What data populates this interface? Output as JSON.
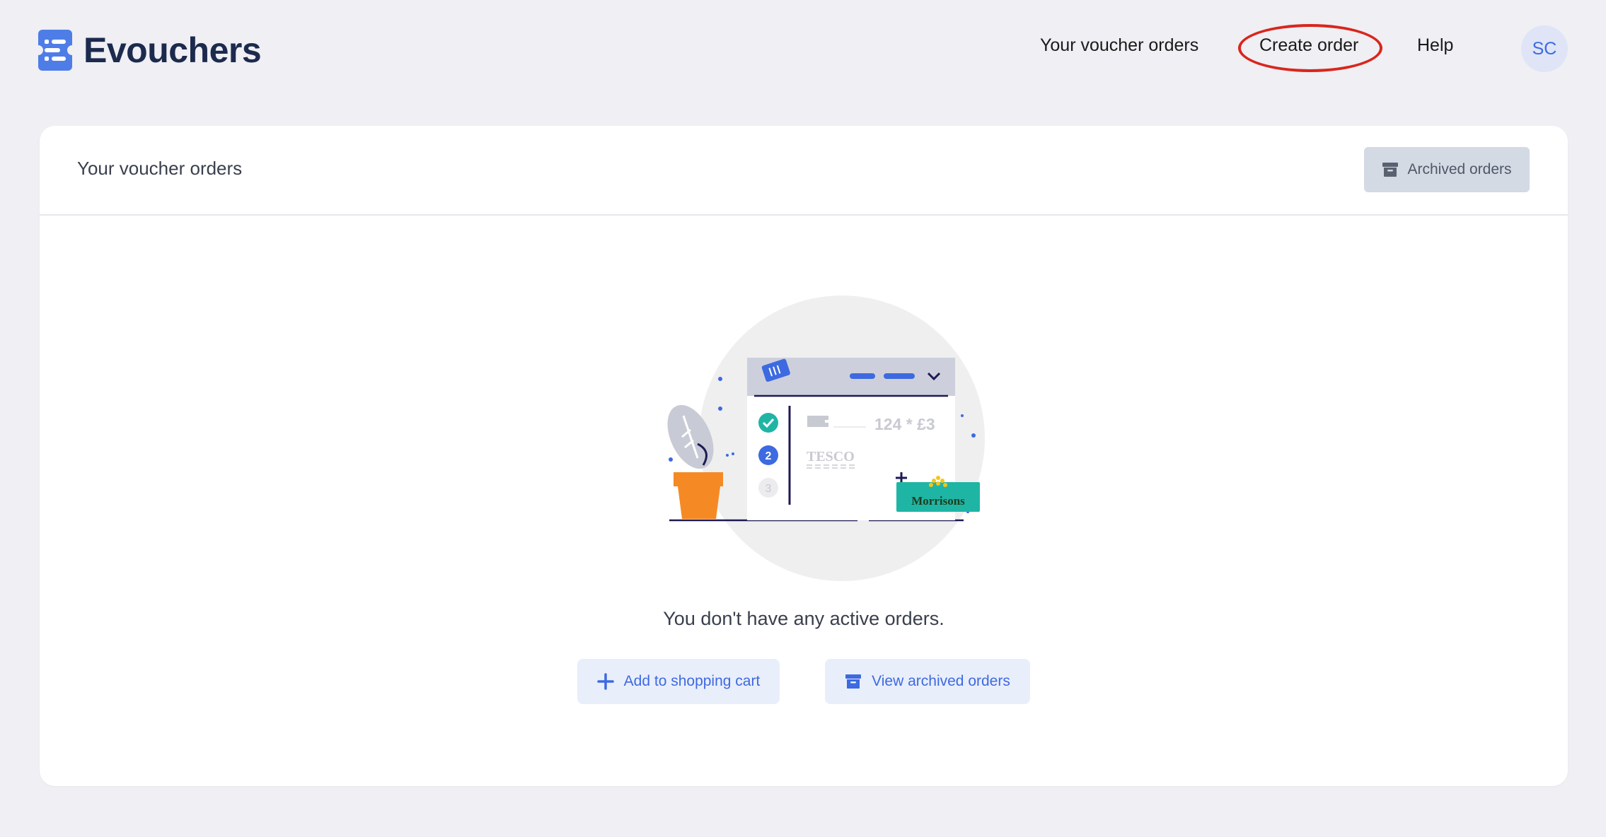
{
  "brand": {
    "name": "Evouchers"
  },
  "nav": {
    "orders": "Your voucher orders",
    "create": "Create order",
    "help": "Help",
    "avatar_initials": "SC"
  },
  "card": {
    "title": "Your voucher orders",
    "archived_button": "Archived orders"
  },
  "illustration": {
    "order_line": "124 * £3",
    "step_2": "2",
    "step_3": "3",
    "brand_tesco": "TESCO",
    "brand_morrisons": "Morrisons"
  },
  "empty_state": {
    "message": "You don't have any active orders.",
    "add_button": "Add to shopping cart",
    "view_archived_button": "View archived orders"
  },
  "colors": {
    "accent": "#3d6ae0",
    "highlight": "#d9261c",
    "teal": "#1fb5a5",
    "orange": "#f58a24"
  }
}
